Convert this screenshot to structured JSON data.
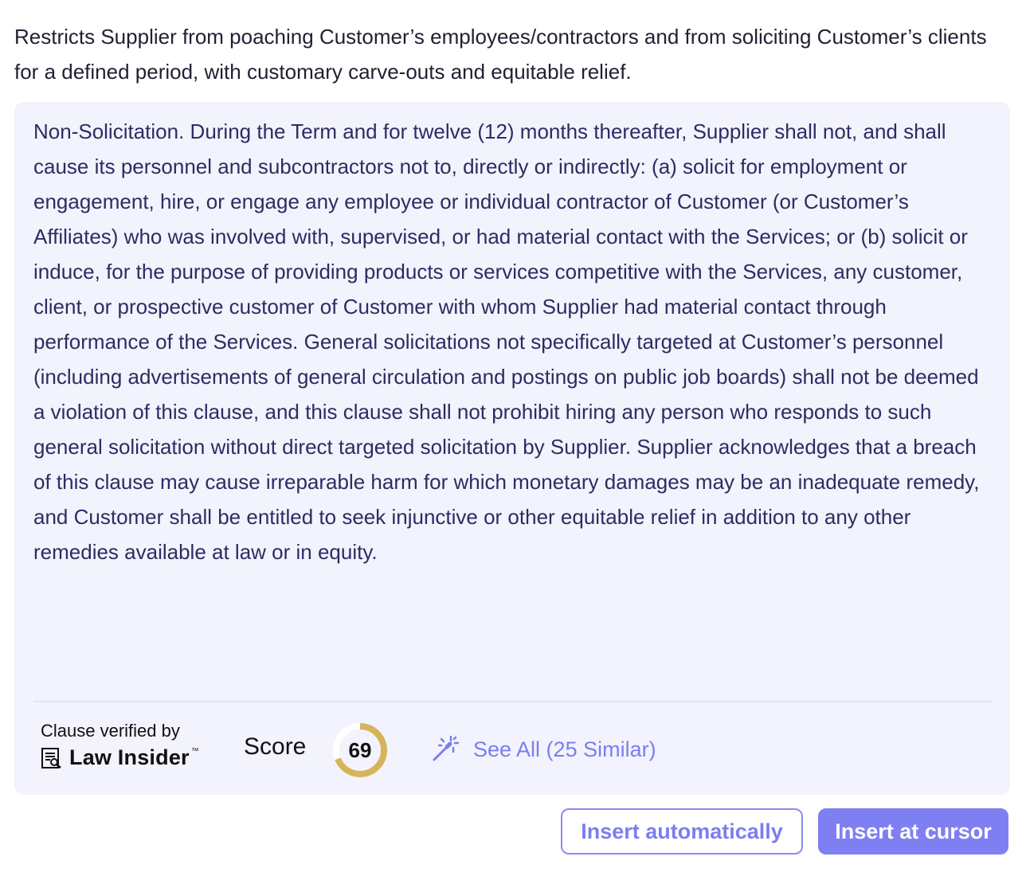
{
  "summary": "Restricts Supplier from poaching Customer’s employees/contractors and from soliciting Customer’s clients for a defined period, with customary carve-outs and equitable relief.",
  "clause": {
    "text": "Non-Solicitation. During the Term and for twelve (12) months thereafter, Supplier shall not, and shall cause its personnel and subcontractors not to, directly or indirectly: (a) solicit for employment or engagement, hire, or engage any employee or individual contractor of Customer (or Customer’s Affiliates) who was involved with, supervised, or had material contact with the Services; or (b) solicit or induce, for the purpose of providing products or services competitive with the Services, any customer, client, or prospective customer of Customer with whom Supplier had material contact through performance of the Services. General solicitations not specifically targeted at Customer’s personnel (including advertisements of general circulation and postings on public job boards) shall not be deemed a violation of this clause, and this clause shall not prohibit hiring any person who responds to such general solicitation without direct targeted solicitation by Supplier. Supplier acknowledges that a breach of this clause may cause irreparable harm for which monetary damages may be an inadequate remedy, and Customer shall be entitled to seek injunctive or other equitable relief in addition to any other remedies available at law or in equity."
  },
  "footer": {
    "verified_label": "Clause verified by",
    "brand_name": "Law Insider",
    "brand_tm": "™",
    "brand_icon": "document-search-icon",
    "score_label": "Score",
    "score_value": "69",
    "score_fraction": 0.69,
    "score_color": "#d6b45a",
    "score_track_color": "#ffffff",
    "see_all_icon": "magic-wand-icon",
    "see_all_label": "See All (25 Similar)"
  },
  "actions": {
    "insert_auto_label": "Insert automatically",
    "insert_cursor_label": "Insert at cursor"
  },
  "colors": {
    "accent": "#7e80f2",
    "card_background": "#f2f3fc",
    "clause_text": "#2b2d63"
  }
}
